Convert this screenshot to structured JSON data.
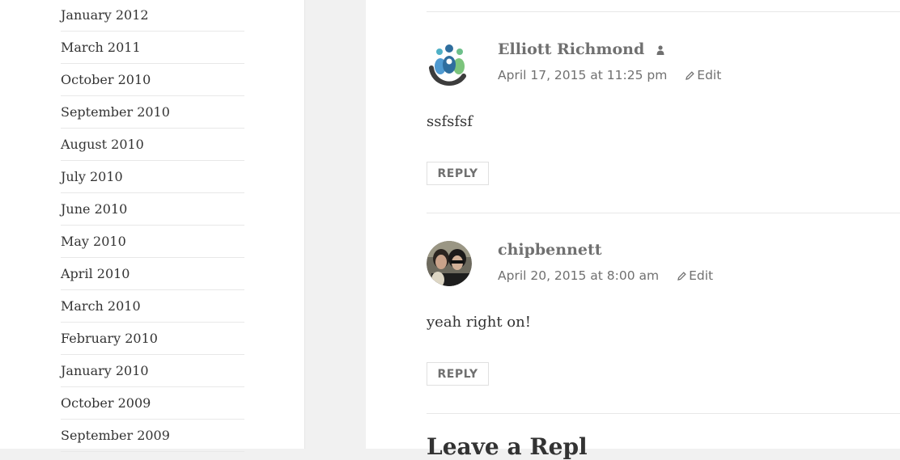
{
  "sidebar": {
    "archives": [
      "January 2012",
      "March 2011",
      "October 2010",
      "September 2010",
      "August 2010",
      "July 2010",
      "June 2010",
      "May 2010",
      "April 2010",
      "March 2010",
      "February 2010",
      "January 2010",
      "October 2009",
      "September 2009"
    ]
  },
  "comments": [
    {
      "author": "Elliott Richmond",
      "date": "April 17, 2015 at 11:25 pm",
      "edit_label": "Edit",
      "text": "ssfsfsf",
      "reply_label": "REPLY"
    },
    {
      "author": "chipbennett",
      "date": "April 20, 2015 at 8:00 am",
      "edit_label": "Edit",
      "text": "yeah right on!",
      "reply_label": "REPLY"
    }
  ],
  "leave_reply": "Leave a Repl",
  "colors": {
    "meta": "#707070",
    "text": "#333333",
    "sidebar_bg": "#ffffff",
    "page_bg": "#f1f1f1"
  }
}
